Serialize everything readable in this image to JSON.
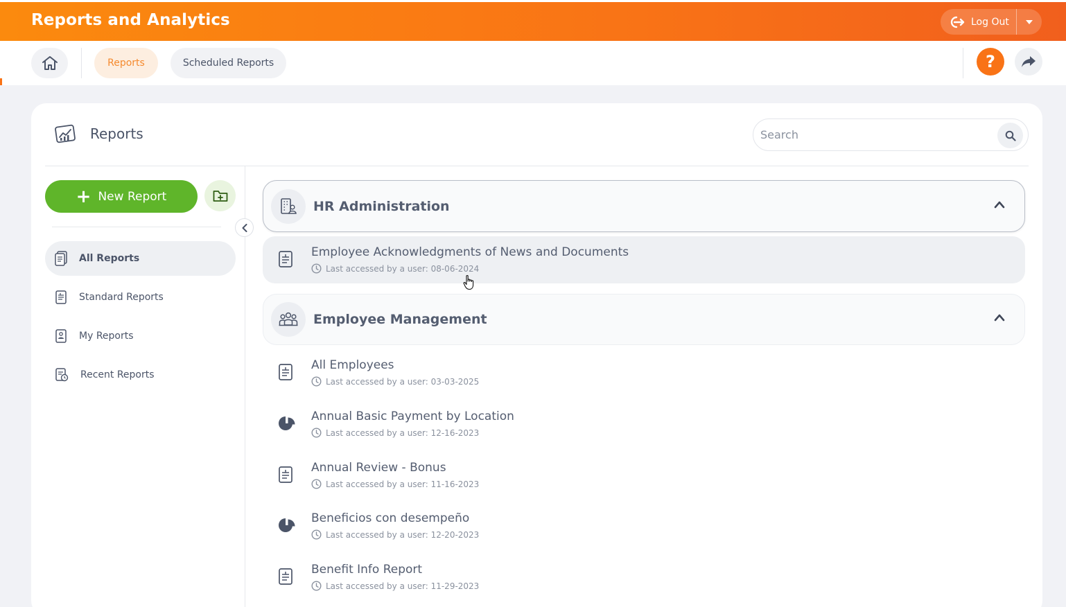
{
  "header": {
    "title": "Reports and Analytics",
    "logout_label": "Log Out"
  },
  "nav": {
    "tabs": [
      {
        "label": "Reports",
        "active": true
      },
      {
        "label": "Scheduled Reports",
        "active": false
      }
    ],
    "help_label": "?"
  },
  "card": {
    "title": "Reports",
    "search_placeholder": "Search"
  },
  "sidebar": {
    "new_report_label": "New Report",
    "items": [
      {
        "label": "All Reports",
        "active": true
      },
      {
        "label": "Standard Reports",
        "active": false
      },
      {
        "label": "My Reports",
        "active": false
      },
      {
        "label": "Recent Reports",
        "active": false
      }
    ]
  },
  "groups": [
    {
      "title": "HR Administration",
      "reports": [
        {
          "name": "Employee Acknowledgments of News and Documents",
          "meta": "Last accessed by a user: 08-06-2024",
          "icon": "document-icon"
        }
      ]
    },
    {
      "title": "Employee Management",
      "reports": [
        {
          "name": "All Employees",
          "meta": "Last accessed by a user: 03-03-2025",
          "icon": "document-icon"
        },
        {
          "name": "Annual Basic Payment by Location",
          "meta": "Last accessed by a user: 12-16-2023",
          "icon": "pie-chart-icon"
        },
        {
          "name": "Annual Review - Bonus",
          "meta": "Last accessed by a user: 11-16-2023",
          "icon": "document-icon"
        },
        {
          "name": "Beneficios con desempeño",
          "meta": "Last accessed by a user: 12-20-2023",
          "icon": "pie-chart-icon"
        },
        {
          "name": "Benefit Info Report",
          "meta": "Last accessed by a user: 11-29-2023",
          "icon": "document-icon"
        }
      ]
    }
  ],
  "colors": {
    "accent_orange": "#f97316",
    "new_report_green": "#5fb52a",
    "text": "#4b5468"
  }
}
